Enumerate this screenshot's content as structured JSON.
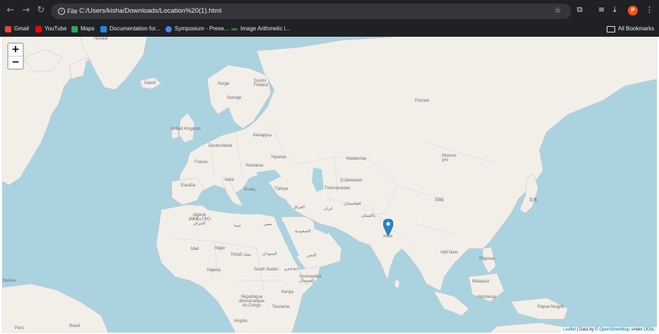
{
  "browser": {
    "file_chip": "File",
    "url": "C:/Users/kisha/Downloads/Location%20(1).html",
    "avatar_letter": "P",
    "bookmarks": [
      {
        "label": "Gmail",
        "color": "#ea4335"
      },
      {
        "label": "YouTube",
        "color": "#ff0000"
      },
      {
        "label": "Maps",
        "color": "#34a853"
      },
      {
        "label": "Documentation for...",
        "color": "#1e88e5"
      },
      {
        "label": "Symposium - Prese...",
        "color": "#4285f4"
      },
      {
        "label": "Image Arithmetic i...",
        "color": "#2e7d32"
      }
    ],
    "all_bookmarks": "All Bookmarks"
  },
  "map": {
    "zoom_in": "+",
    "zoom_out": "−",
    "attribution": {
      "leaflet": "Leaflet",
      "sep": " | Data by © ",
      "osm": "OpenStreetMap",
      "under": ", under ",
      "odbl": "ODbL"
    },
    "marker_color": "#2a81cb",
    "land_color": "#f2efe9",
    "water_color": "#aad3df",
    "place_labels": [
      "Nunaat",
      "Ísland",
      "Norge",
      "Suomi Finland",
      "Sverige",
      "United Kingdom",
      "Беларусь",
      "Deutschland",
      "France",
      "România",
      "Україна",
      "España",
      "Italia",
      "Ελλάς",
      "Türkiye",
      "Россия",
      "Казахстан",
      "Монгол улс",
      "O'zbekiston",
      "Türkmenistan",
      "افغانستان",
      "العراق",
      "ایران",
      "پاکستان",
      "中国",
      "日本",
      "Algérie ⵍⵣⵣⴰⵢⴻⵔ الجزائر",
      "ليبيا",
      "مصر",
      "السعودية",
      "Mali",
      "Niger",
      "Tchad تشاد",
      "السودان",
      "Nigeria",
      "South Sudan",
      "ኢትዮጵያ",
      "Soomaaliya الصومال",
      "Kenya",
      "République démocratique du Congo",
      "Tanzania",
      "Angola",
      "Brasil",
      "Bolivia",
      "India",
      "Việt Nam",
      "Pilipinas",
      "Malaysia",
      "Indonesia",
      "Papua Niugini",
      "اليمن",
      "Perú"
    ]
  }
}
